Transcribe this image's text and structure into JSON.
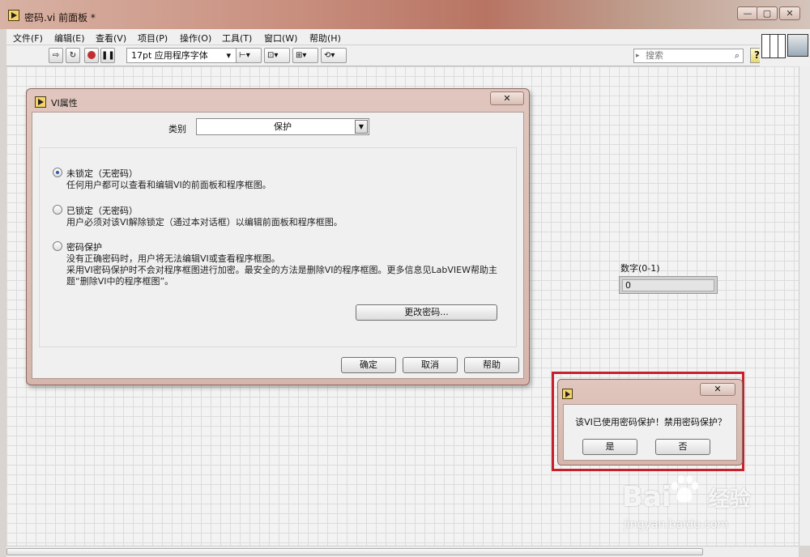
{
  "window": {
    "title": "密码.vi 前面板 *",
    "controls": {
      "minimize": "—",
      "restore": "▢",
      "close": "✕"
    }
  },
  "menu": [
    "文件(F)",
    "编辑(E)",
    "查看(V)",
    "项目(P)",
    "操作(O)",
    "工具(T)",
    "窗口(W)",
    "帮助(H)"
  ],
  "toolbar": {
    "font": "17pt 应用程序字体",
    "search_placeholder": "搜索",
    "help_label": "?"
  },
  "numeric": {
    "label": "数字(0-1)",
    "value": "0"
  },
  "vi_dialog": {
    "title": "VI属性",
    "close_label": "✕",
    "category_label": "类别",
    "category_value": "保护",
    "options": [
      {
        "title": "未锁定（无密码）",
        "desc": [
          "任何用户都可以查看和编辑VI的前面板和程序框图。"
        ],
        "selected": true
      },
      {
        "title": "已锁定（无密码）",
        "desc": [
          "用户必须对该VI解除锁定（通过本对话框）以编辑前面板和程序框图。"
        ],
        "selected": false
      },
      {
        "title": "密码保护",
        "desc": [
          "没有正确密码时，用户将无法编辑VI或查看程序框图。",
          "采用VI密码保护时不会对程序框图进行加密。最安全的方法是删除VI的程序框图。更多信息见LabVIEW帮助主",
          "题“删除VI中的程序框图”。"
        ],
        "selected": false
      }
    ],
    "change_password": "更改密码...",
    "ok": "确定",
    "cancel": "取消",
    "help": "帮助"
  },
  "msg_dialog": {
    "close_label": "✕",
    "message": "该VI已使用密码保护！禁用密码保护？",
    "yes": "是",
    "no": "否"
  },
  "watermark": {
    "brand": "Bai",
    "brand2": "经验",
    "url": "jingyan.baidu.com"
  },
  "colors": {
    "highlight": "#c8202a",
    "radio_selected": "#2a5db0"
  }
}
